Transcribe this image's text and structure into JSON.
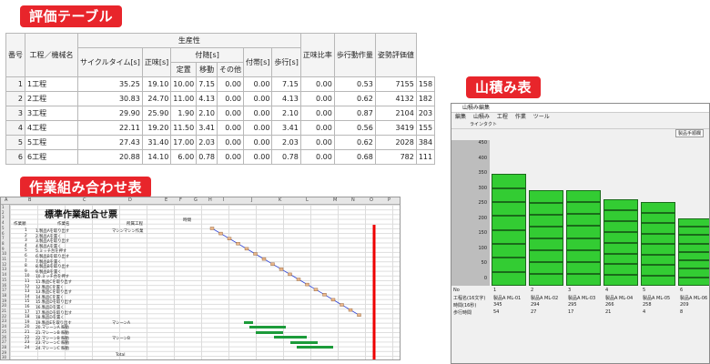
{
  "titles": {
    "eval": "評価テーブル",
    "combo": "作業組み合わせ表",
    "yama": "山積み表"
  },
  "eval_table": {
    "group_header": "生産性",
    "headers": [
      "番号",
      "工程／機械名",
      "サイクルタイム[s]",
      "正味[s]",
      "付随[s]",
      "付帯[s]",
      "歩行[s]",
      "手待ち[s]",
      "正味比率",
      "歩行動作量",
      "姿勢評価値"
    ],
    "sub_headers": [
      "定置",
      "移動",
      "その他"
    ],
    "rows": [
      {
        "no": "1",
        "name": "1工程",
        "cycle": "35.25",
        "net": "19.10",
        "a": "10.00",
        "b": "7.15",
        "c": "0.00",
        "futai": "0.00",
        "walk": "7.15",
        "wait": "0.00",
        "ratio": "0.53",
        "steps": "7155",
        "posture": "158"
      },
      {
        "no": "2",
        "name": "2工程",
        "cycle": "30.83",
        "net": "24.70",
        "a": "11.00",
        "b": "4.13",
        "c": "0.00",
        "futai": "0.00",
        "walk": "4.13",
        "wait": "0.00",
        "ratio": "0.62",
        "steps": "4132",
        "posture": "182"
      },
      {
        "no": "3",
        "name": "3工程",
        "cycle": "29.90",
        "net": "25.90",
        "a": "1.90",
        "b": "2.10",
        "c": "0.00",
        "futai": "0.00",
        "walk": "2.10",
        "wait": "0.00",
        "ratio": "0.87",
        "steps": "2104",
        "posture": "203"
      },
      {
        "no": "4",
        "name": "4工程",
        "cycle": "22.11",
        "net": "19.20",
        "a": "11.50",
        "b": "3.41",
        "c": "0.00",
        "futai": "0.00",
        "walk": "3.41",
        "wait": "0.00",
        "ratio": "0.56",
        "steps": "3419",
        "posture": "155"
      },
      {
        "no": "5",
        "name": "5工程",
        "cycle": "27.43",
        "net": "31.40",
        "a": "17.00",
        "b": "2.03",
        "c": "0.00",
        "futai": "0.00",
        "walk": "2.03",
        "wait": "0.00",
        "ratio": "0.62",
        "steps": "2028",
        "posture": "384"
      },
      {
        "no": "6",
        "name": "6工程",
        "cycle": "20.88",
        "net": "14.10",
        "a": "6.00",
        "b": "0.78",
        "c": "0.00",
        "futai": "0.00",
        "walk": "0.78",
        "wait": "0.00",
        "ratio": "0.68",
        "steps": "782",
        "posture": "111"
      }
    ]
  },
  "sheet": {
    "title": "標準作業組合せ票",
    "col_letters": [
      "A",
      "B",
      "C",
      "D",
      "E",
      "F",
      "G",
      "H",
      "I",
      "J",
      "K",
      "L",
      "M",
      "N",
      "O",
      "P"
    ],
    "header_labels": {
      "task_no": "作業順",
      "task_name": "作業名",
      "process": "所属工程",
      "time": "時間",
      "total": "Total"
    },
    "rows": [
      {
        "no": "1",
        "name": "1.製品Aを取り出す",
        "proc": "マシンマシン作業"
      },
      {
        "no": "2",
        "name": "2.製品Aを置く",
        "proc": ""
      },
      {
        "no": "3",
        "name": "3.製品Aを取り出す",
        "proc": ""
      },
      {
        "no": "4",
        "name": "4.製品Aを置く",
        "proc": ""
      },
      {
        "no": "5",
        "name": "5.ミッチ台を押す",
        "proc": ""
      },
      {
        "no": "6",
        "name": "6.製品Bを取り出す",
        "proc": ""
      },
      {
        "no": "7",
        "name": "7.製品Bを置く",
        "proc": ""
      },
      {
        "no": "8",
        "name": "8.製品Bを取り出す",
        "proc": ""
      },
      {
        "no": "9",
        "name": "9.製品Bを置く",
        "proc": ""
      },
      {
        "no": "10",
        "name": "10.ミッチ台を押す",
        "proc": ""
      },
      {
        "no": "11",
        "name": "11.製品Cを取り出す",
        "proc": ""
      },
      {
        "no": "12",
        "name": "12.製品Cを置く",
        "proc": ""
      },
      {
        "no": "13",
        "name": "13.製品Cを取り出す",
        "proc": ""
      },
      {
        "no": "14",
        "name": "14.製品Cを置く",
        "proc": ""
      },
      {
        "no": "15",
        "name": "15.製品Dを取り出す",
        "proc": ""
      },
      {
        "no": "16",
        "name": "16.製品Dを置く",
        "proc": ""
      },
      {
        "no": "17",
        "name": "17.製品Dを取り出す",
        "proc": ""
      },
      {
        "no": "18",
        "name": "18.製品Dを置く",
        "proc": ""
      },
      {
        "no": "19",
        "name": "19.製品Eを取り出す",
        "proc": "マシーンA"
      },
      {
        "no": "20",
        "name": "20.マシーンA 稼動",
        "proc": ""
      },
      {
        "no": "21",
        "name": "21.マシーンB 稼動",
        "proc": ""
      },
      {
        "no": "22",
        "name": "22.マシーンB 稼動",
        "proc": "マシーンB"
      },
      {
        "no": "23",
        "name": "23.マシーンC 稼動",
        "proc": ""
      },
      {
        "no": "24",
        "name": "24.マシーンC 稼動",
        "proc": ""
      }
    ]
  },
  "yama": {
    "window_title": "山積み編集",
    "menu": [
      "編集",
      "山積み",
      "工程",
      "作業",
      "ツール"
    ],
    "tool_label": "ラインタクト",
    "top_label": "製品手順欄",
    "y_ticks": [
      "450",
      "400",
      "350",
      "300",
      "250",
      "200",
      "150",
      "100",
      "50",
      "0"
    ],
    "bottom_labels": {
      "no": "No",
      "process": "工程名(16文字)",
      "time": "時間(16秒)",
      "step": "歩行時間"
    },
    "columns": [
      {
        "no": "1",
        "name": "製品A ML-01",
        "time": "345",
        "step": "54"
      },
      {
        "no": "2",
        "name": "製品A ML-02",
        "time": "294",
        "step": "27"
      },
      {
        "no": "3",
        "name": "製品A ML-03",
        "time": "295",
        "step": "17"
      },
      {
        "no": "4",
        "name": "製品A ML-04",
        "time": "266",
        "step": "21"
      },
      {
        "no": "5",
        "name": "製品A ML-05",
        "time": "258",
        "step": "4"
      },
      {
        "no": "6",
        "name": "製品A ML-06",
        "time": "209",
        "step": "8"
      }
    ]
  }
}
